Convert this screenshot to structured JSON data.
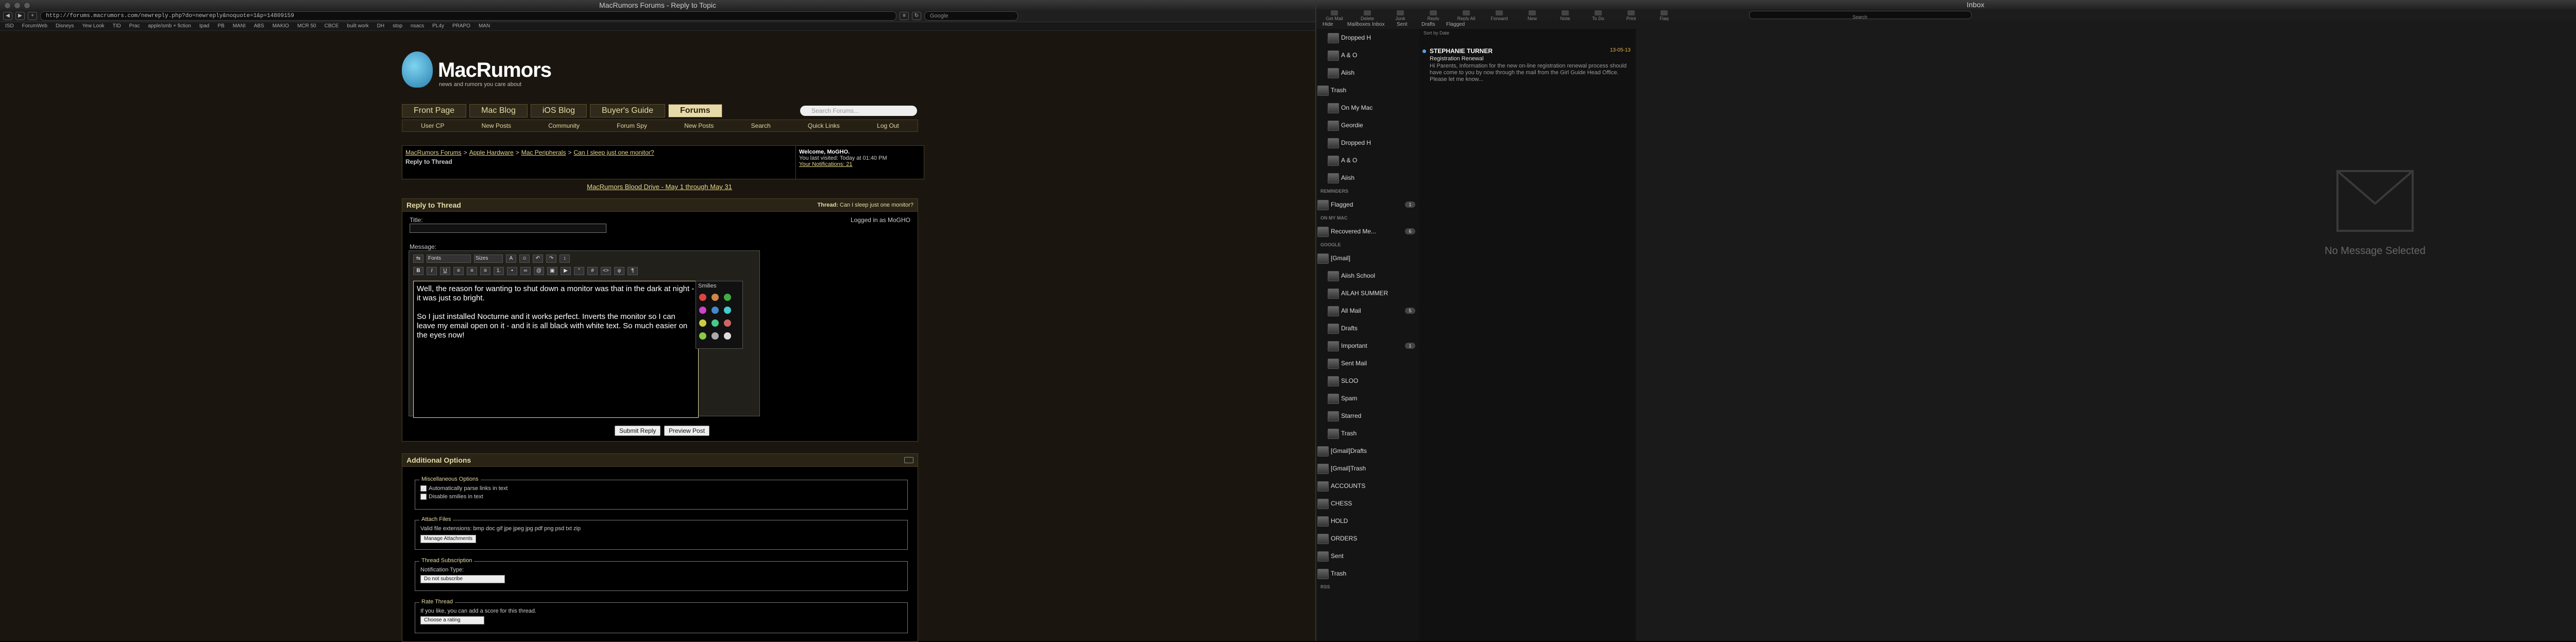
{
  "browser": {
    "window_title": "MacRumors Forums - Reply to Topic",
    "url": "http://forums.macrumors.com/newreply.php?do=newreply&noquote=1&p=14809159",
    "google_placeholder": "Google",
    "bookmarks": [
      "ISD",
      "ForumWeb",
      "Disneys",
      "Yew Look",
      "TID",
      "Prac",
      "apple/smb + fiction",
      "Ipad",
      "PB",
      "MANI",
      "ABS",
      "MAKIO",
      "MCR 50",
      "CBCE",
      "built work",
      "DH",
      "stop",
      "nsacs",
      "PL4y",
      "PRAPO",
      "MAN"
    ]
  },
  "site": {
    "logo_name": "MacRumors",
    "logo_tagline": "news and rumors you care about",
    "tabs": [
      {
        "label": "Front Page",
        "active": false
      },
      {
        "label": "Mac Blog",
        "active": false
      },
      {
        "label": "iOS Blog",
        "active": false
      },
      {
        "label": "Buyer's Guide",
        "active": false
      },
      {
        "label": "Forums",
        "active": true
      }
    ],
    "search_placeholder": "Search Forums...",
    "subnav": [
      "User CP",
      "New Posts",
      "Community",
      "Forum Spy",
      "New Posts",
      "Search",
      "Quick Links",
      "Log Out"
    ],
    "tooltip": "MacRumors"
  },
  "breadcrumb": {
    "items": [
      "MacRumors Forums",
      "Apple Hardware",
      "Mac Peripherals",
      "Can I sleep just one monitor?"
    ],
    "page_title": "Reply to Thread"
  },
  "welcome": {
    "line1": "Welcome, MoGHO.",
    "line2": "You last visited: Today at 01:40 PM",
    "line3": "Your Notifications: 21"
  },
  "drive_link": "MacRumors Blood Drive - May 1 through May 31",
  "reply": {
    "heading": "Reply to Thread",
    "thread_label": "Thread:",
    "thread_name": "Can I sleep just one monitor?",
    "title_label": "Title:",
    "logged_in": "Logged in as MoGHO",
    "message_label": "Message:",
    "font_select": "Fonts",
    "size_select": "Sizes",
    "message_text": "Well, the reason for wanting to shut down a monitor was that in the dark at night - it was just so bright.\n\nSo I just installed Nocturne and it works perfect. Inverts the monitor so I can leave my email open on it - and it is all black with white text. So much easier on the eyes now!",
    "smilies_label": "Smilies",
    "submit_label": "Submit Reply",
    "preview_label": "Preview Post"
  },
  "smilie_colors": [
    "#d44",
    "#c84",
    "#4a4",
    "#c4c",
    "#48c",
    "#4cc",
    "#cc4",
    "#4c8",
    "#c66",
    "#8c4",
    "#aaa",
    "#ddd"
  ],
  "options": {
    "heading": "Additional Options",
    "misc_legend": "Miscellaneous Options",
    "parse_links": "Automatically parse links in text",
    "disable_smilies": "Disable smilies in text",
    "attach_legend": "Attach Files",
    "valid_ext": "Valid file extensions: bmp doc gif jpe jpeg jpg pdf png psd txt zip",
    "manage_btn": "Manage Attachments",
    "sub_legend": "Thread Subscription",
    "notif_type": "Notification Type:",
    "notif_value": "Do not subscribe",
    "rate_legend": "Rate Thread",
    "rate_text": "If you like, you can add a score for this thread.",
    "rate_value": "Choose a rating"
  },
  "mail": {
    "window_title": "Inbox",
    "toolbar": [
      "Get Mail",
      "Delete",
      "Junk",
      "Reply",
      "Reply All",
      "Forward",
      "New Message",
      "Note",
      "To Do",
      "Print",
      "Flag"
    ],
    "search_label": "Search",
    "sortbar": [
      "Hide",
      "Mailboxes",
      "Inbox",
      "Sent",
      "Drafts",
      "Flagged"
    ],
    "sort_by": "Sort by Date",
    "folders": [
      {
        "label": "Dropped H",
        "indent": 1,
        "count": ""
      },
      {
        "label": "A & O",
        "indent": 1,
        "count": ""
      },
      {
        "label": "Aiish",
        "indent": 1,
        "count": ""
      },
      {
        "label": "Trash",
        "indent": 0,
        "count": ""
      },
      {
        "label": "On My Mac",
        "indent": 1,
        "count": ""
      },
      {
        "label": "Geordie",
        "indent": 1,
        "count": ""
      },
      {
        "label": "Dropped H",
        "indent": 1,
        "count": ""
      },
      {
        "label": "A & O",
        "indent": 1,
        "count": ""
      },
      {
        "label": "Aiish",
        "indent": 1,
        "count": ""
      }
    ],
    "reminders_head": "REMINDERS",
    "flagged": {
      "label": "Flagged",
      "count": "1"
    },
    "on_my_mac_head": "ON MY MAC",
    "recovered": {
      "label": "Recovered Me...",
      "count": "6"
    },
    "google_head": "GOOGLE",
    "gmail_folders": [
      {
        "label": "[Gmail]",
        "indent": 0,
        "count": ""
      },
      {
        "label": "Aiish School",
        "indent": 1,
        "count": ""
      },
      {
        "label": "AILAH SUMMER",
        "indent": 1,
        "count": ""
      },
      {
        "label": "All Mail",
        "indent": 1,
        "count": "5"
      },
      {
        "label": "Drafts",
        "indent": 1,
        "count": ""
      },
      {
        "label": "Important",
        "indent": 1,
        "count": "1"
      },
      {
        "label": "Sent Mail",
        "indent": 1,
        "count": ""
      },
      {
        "label": "SLOO",
        "indent": 1,
        "count": ""
      },
      {
        "label": "Spam",
        "indent": 1,
        "count": ""
      },
      {
        "label": "Starred",
        "indent": 1,
        "count": ""
      },
      {
        "label": "Trash",
        "indent": 1,
        "count": ""
      },
      {
        "label": "[Gmail]Drafts",
        "indent": 0,
        "count": ""
      },
      {
        "label": "[Gmail]Trash",
        "indent": 0,
        "count": ""
      },
      {
        "label": "ACCOUNTS",
        "indent": 0,
        "count": ""
      },
      {
        "label": "CHESS",
        "indent": 0,
        "count": ""
      },
      {
        "label": "HOLD",
        "indent": 0,
        "count": ""
      },
      {
        "label": "ORDERS",
        "indent": 0,
        "count": ""
      },
      {
        "label": "Sent",
        "indent": 0,
        "count": ""
      },
      {
        "label": "Trash",
        "indent": 0,
        "count": ""
      }
    ],
    "rss_head": "RSS",
    "message": {
      "sender": "STEPHANIE TURNER",
      "date": "13-05-13",
      "subject": "Registration Renewal",
      "snippet": "Hi Parents, Information for the new on-line registration renewal process should have come to you by now through the mail from the Girl Guide Head Office. Please let me know..."
    },
    "no_message": "No Message Selected"
  }
}
